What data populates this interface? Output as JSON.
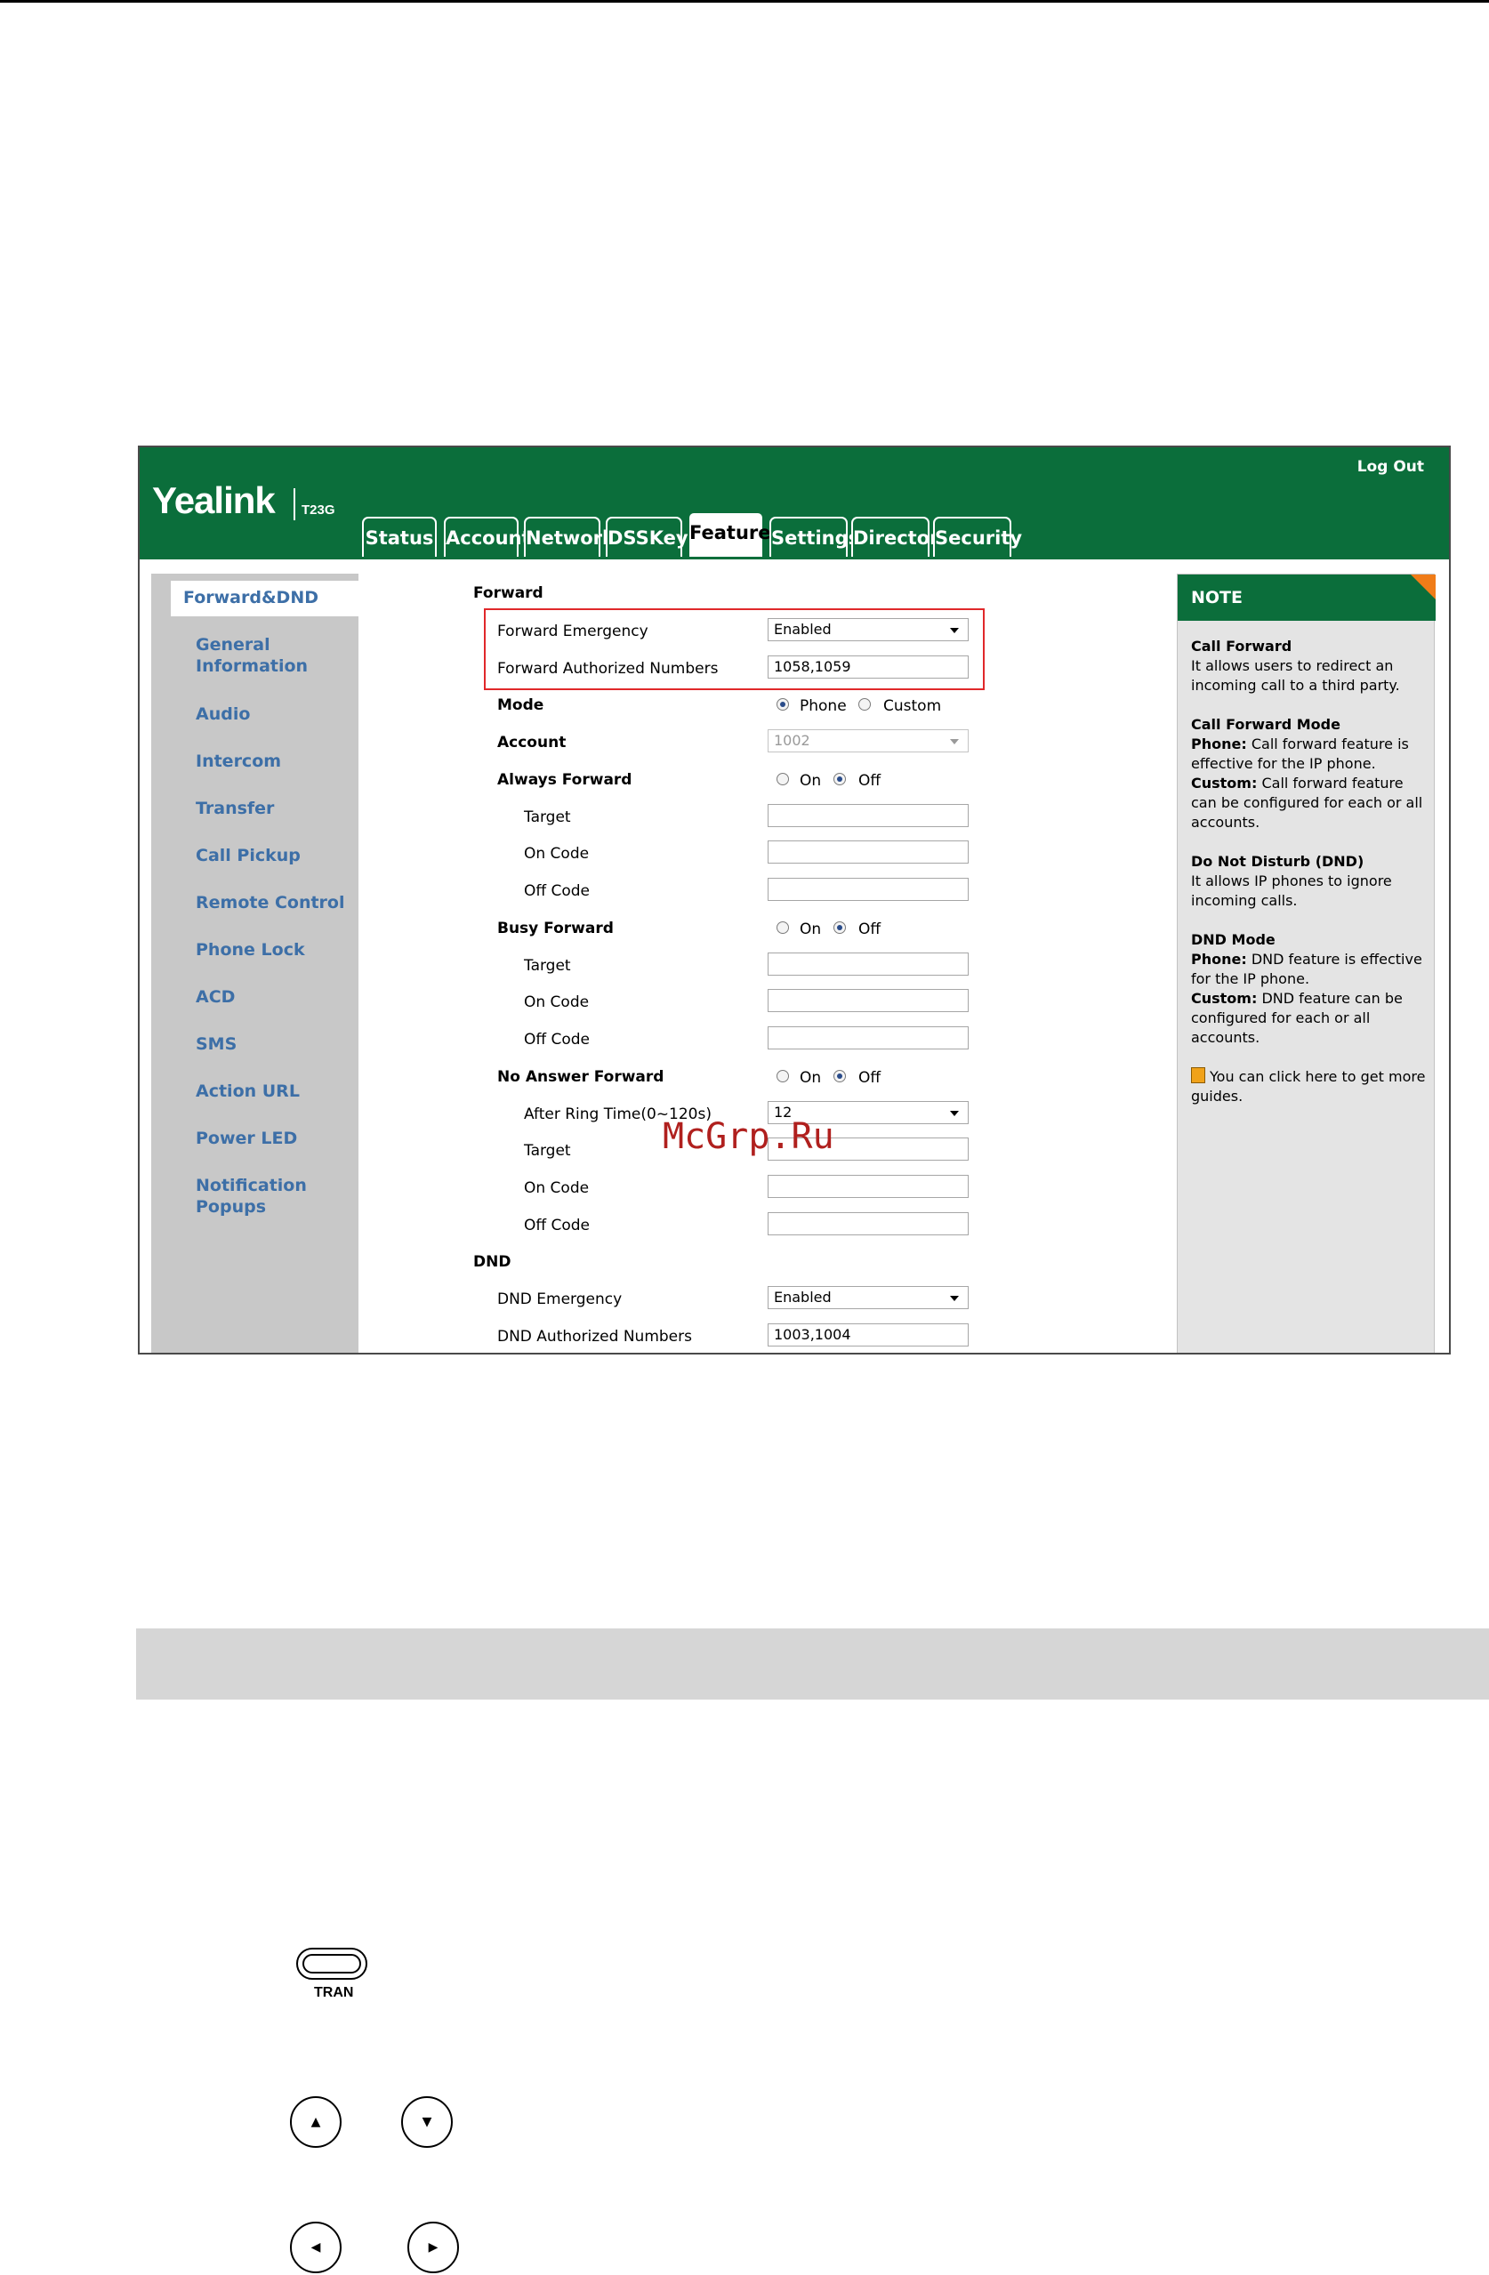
{
  "header": {
    "logout": "Log Out",
    "logo": "Yealink",
    "model": "T23G",
    "tabs": [
      "Status",
      "Account",
      "Network",
      "DSSKey",
      "Features",
      "Settings",
      "Directory",
      "Security"
    ],
    "active_tab": "Features"
  },
  "sidebar": {
    "active": "Forward&DND",
    "items": [
      "General\nInformation",
      "Audio",
      "Intercom",
      "Transfer",
      "Call Pickup",
      "Remote Control",
      "Phone Lock",
      "ACD",
      "SMS",
      "Action URL",
      "Power LED",
      "Notification Popups"
    ]
  },
  "forward": {
    "section_title": "Forward",
    "emergency_label": "Forward Emergency",
    "emergency_value": "Enabled",
    "authorized_label": "Forward Authorized Numbers",
    "authorized_value": "1058,1059",
    "mode_label": "Mode",
    "mode_phone": "Phone",
    "mode_custom": "Custom",
    "account_label": "Account",
    "account_value": "1002",
    "always_label": "Always Forward",
    "busy_label": "Busy Forward",
    "noanswer_label": "No Answer Forward",
    "on": "On",
    "off": "Off",
    "target": "Target",
    "on_code": "On Code",
    "off_code": "Off Code",
    "ring_time_label": "After Ring Time(0~120s)",
    "ring_time_value": "12"
  },
  "dnd": {
    "section_title": "DND",
    "emergency_label": "DND Emergency",
    "emergency_value": "Enabled",
    "authorized_label": "DND Authorized Numbers",
    "authorized_value": "1003,1004"
  },
  "note": {
    "title": "NOTE",
    "cf_title": "Call Forward",
    "cf_text": "It allows users to redirect an incoming call to a third party.",
    "cfm_title": "Call Forward Mode",
    "cfm_phone_label": "Phone:",
    "cfm_phone_text": "Call forward feature is effective for the IP phone.",
    "cfm_custom_label": "Custom:",
    "cfm_custom_text": "Call forward feature can be configured for each or all accounts.",
    "dnd_title": "Do Not Disturb (DND)",
    "dnd_text": "It allows IP phones to ignore incoming calls.",
    "dndm_title": "DND Mode",
    "dndm_phone_label": "Phone:",
    "dndm_phone_text": "DND feature is effective for the IP phone.",
    "dndm_custom_label": "Custom:",
    "dndm_custom_text": "DND feature can be configured for each or all accounts.",
    "guide_text": "You can click here to get more guides."
  },
  "watermark": "McGrp.Ru",
  "keys": {
    "tran_label": "TRAN",
    "up": "▲",
    "down": "▼",
    "left": "◀",
    "right": "▶"
  },
  "colors": {
    "brand_green": "#0b6e3b",
    "sidebar_link": "#3d6fa7",
    "highlight_red": "#e0282a",
    "note_corner": "#f07c18"
  }
}
